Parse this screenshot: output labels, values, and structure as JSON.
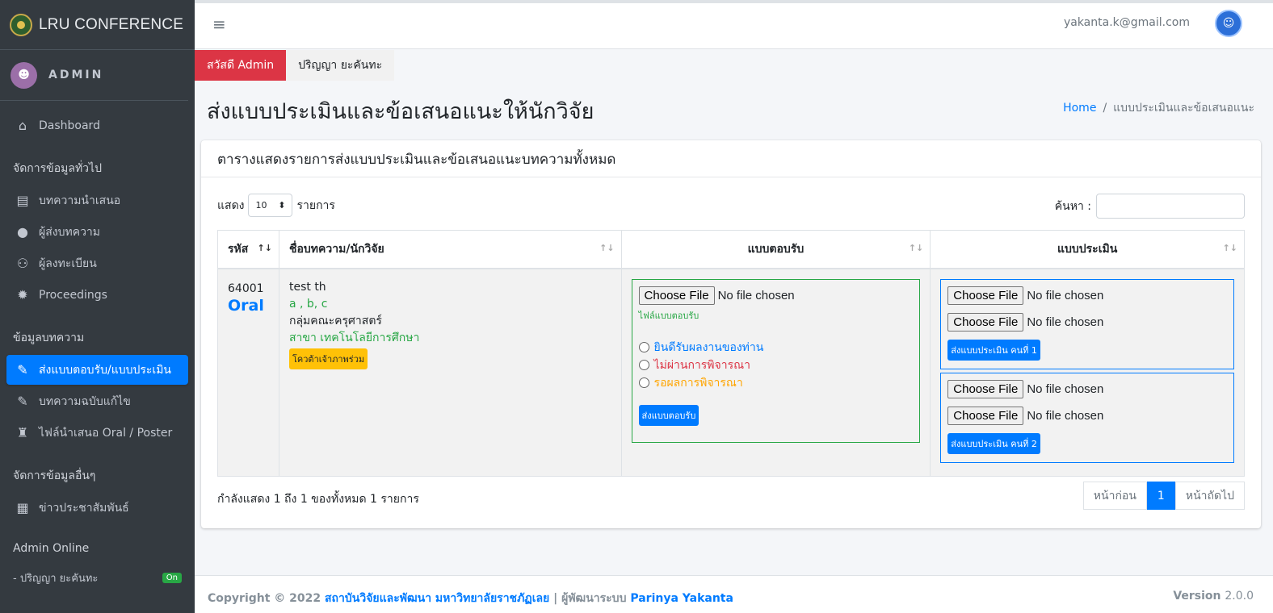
{
  "brand": {
    "title": "LRU CONFERENCE"
  },
  "sidebar": {
    "user": "ADMIN",
    "dashboard": "Dashboard",
    "section_general": "จัดการข้อมูลทั่วไป",
    "items_general": [
      "บทความนำเสนอ",
      "ผู้ส่งบทความ",
      "ผู้ลงทะเบียน",
      "Proceedings"
    ],
    "section_articles": "ข้อมูลบทความ",
    "items_articles": [
      "ส่งแบบตอบรับ/แบบประเมิน",
      "บทความฉบับแก้ไข",
      "ไฟล์นำเสนอ Oral / Poster"
    ],
    "section_other": "จัดการข้อมูลอื่นๆ",
    "items_other": [
      "ข่าวประชาสัมพันธ์"
    ],
    "online_header": "Admin Online",
    "online_user": "- ปริญญา ยะคันทะ",
    "online_badge": "On"
  },
  "topbar": {
    "email": "yakanta.k@gmail.com"
  },
  "greeting": {
    "hello": "สวัสดี Admin",
    "name": "ปริญญา ยะคันทะ"
  },
  "page": {
    "title": "ส่งแบบประเมินและข้อเสนอแนะให้นักวิจัย",
    "breadcrumb_home": "Home",
    "breadcrumb_sep": "/",
    "breadcrumb_current": "แบบประเมินและข้อเสนอแนะ"
  },
  "card": {
    "header": "ตารางแสดงรายการส่งแบบประเมินและข้อเสนอแนะบทความทั้งหมด",
    "show_label": "แสดง",
    "show_value": "10",
    "show_suffix": "รายการ",
    "search_label": "ค้นหา :"
  },
  "table": {
    "headers": [
      "รหัส",
      "ชื่อบทความ/นักวิจัย",
      "แบบตอบรับ",
      "แบบประเมิน"
    ],
    "row": {
      "code": "64001",
      "type": "Oral",
      "title": "test th",
      "authors": "a , b, c",
      "faculty": "กลุ่มคณะครุศาสตร์",
      "branch": "สาขา เทคโนโลยีการศึกษา",
      "tag": "โควต้าเจ้าภาพร่วม",
      "file_button": "Choose File",
      "file_status": "No file chosen",
      "accept_hint": "ไฟล์แบบตอบรับ",
      "radio_accept": "ยินดีรับผลงานของท่าน",
      "radio_reject": "ไม่ผ่านการพิจารณา",
      "radio_wait": "รอผลการพิจารณา",
      "send_accept": "ส่งแบบตอบรับ",
      "send_eval_1": "ส่งแบบประเมิน คนที่ 1",
      "send_eval_2": "ส่งแบบประเมิน คนที่ 2"
    }
  },
  "footer_info": "กำลังแสดง 1 ถึง 1 ของทั้งหมด 1 รายการ",
  "pager": {
    "prev": "หน้าก่อน",
    "current": "1",
    "next": "หน้าถัดไป"
  },
  "footer": {
    "copyright": "Copyright © 2022",
    "org": "สถาบันวิจัยและพัฒนา มหาวิทยาลัยราชภัฏเลย",
    "dev_label": "| ผู้พัฒนาระบบ",
    "dev": "Parinya Yakanta",
    "version_label": "Version",
    "version": "2.0.0"
  }
}
